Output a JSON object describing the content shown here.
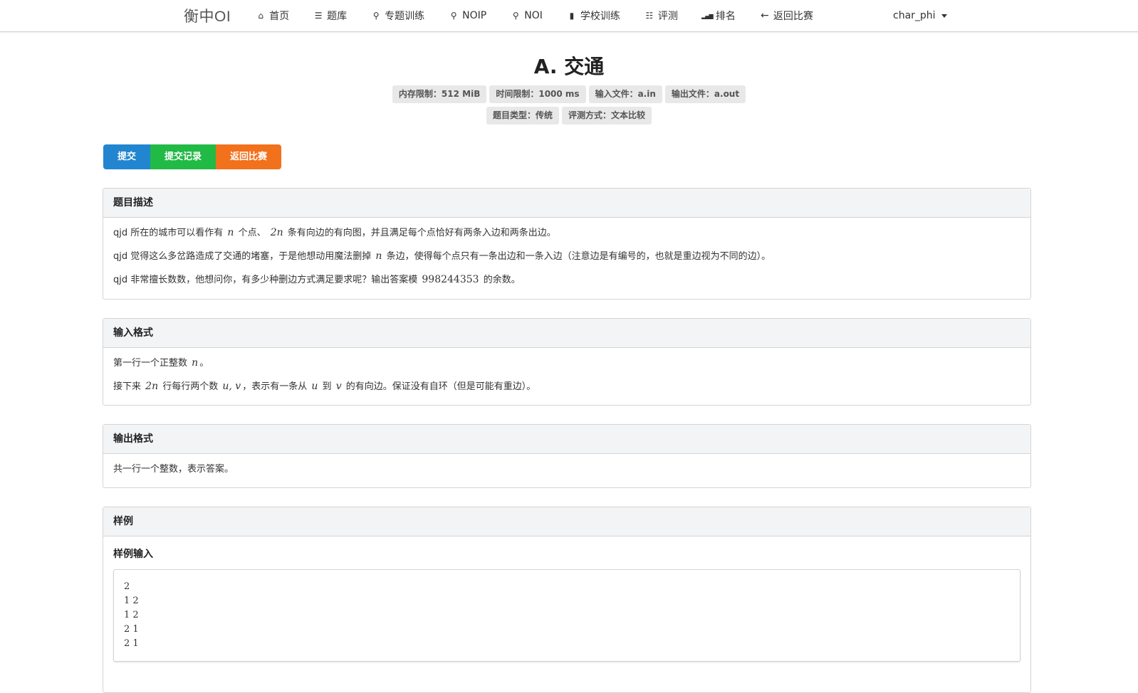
{
  "nav": {
    "brand": "衡中OI",
    "items": [
      {
        "icon": "home-icon",
        "glyph": "⌂",
        "label": "首页"
      },
      {
        "icon": "list-icon",
        "glyph": "☰",
        "label": "题库"
      },
      {
        "icon": "bicycle-icon",
        "glyph": "⚲",
        "label": "专题训练"
      },
      {
        "icon": "bicycle-icon",
        "glyph": "⚲",
        "label": "NOIP"
      },
      {
        "icon": "bicycle-icon",
        "glyph": "⚲",
        "label": "NOI"
      },
      {
        "icon": "building-icon",
        "glyph": "▮",
        "label": "学校训练"
      },
      {
        "icon": "tasks-icon",
        "glyph": "☷",
        "label": "评测"
      },
      {
        "icon": "signal-icon",
        "glyph": "▂▄▆",
        "label": "排名"
      },
      {
        "icon": "arrow-left-icon",
        "glyph": "←",
        "label": "返回比赛"
      }
    ],
    "user": "char_phi"
  },
  "problem": {
    "title": "A. 交通",
    "labels_row1": [
      "内存限制：512 MiB",
      "时间限制：1000 ms",
      "输入文件：a.in",
      "输出文件：a.out"
    ],
    "labels_row2": [
      "题目类型：传统",
      "评测方式：文本比较"
    ]
  },
  "buttons": {
    "submit": "提交",
    "records": "提交记录",
    "back": "返回比赛"
  },
  "description": {
    "header": "题目描述",
    "p1": {
      "a": "qjd 所在的城市可以看作有",
      "m1": "n",
      "b": "个点、",
      "m2": "2n",
      "c": "条有向边的有向图，并且满足每个点恰好有两条入边和两条出边。"
    },
    "p2": {
      "a": "qjd 觉得这么多岔路造成了交通的堵塞，于是他想动用魔法删掉",
      "m1": "n",
      "b": "条边，使得每个点只有一条出边和一条入边（注意边是有编号的，也就是重边视为不同的边）。"
    },
    "p3": {
      "a": "qjd 非常擅长数数，他想问你，有多少种删边方式满足要求呢？输出答案模",
      "m1": "998244353",
      "b": "的余数。"
    }
  },
  "input": {
    "header": "输入格式",
    "p1": {
      "a": "第一行一个正整数",
      "m1": "n",
      "b": "。"
    },
    "p2": {
      "a": "接下来",
      "m1": "2n",
      "b": "行每行两个数",
      "m2": "u, v",
      "c": "，表示有一条从",
      "m3": "u",
      "d": "到",
      "m4": "v",
      "e": "的有向边。保证没有自环（但是可能有重边）。"
    }
  },
  "output": {
    "header": "输出格式",
    "p1": "共一行一个整数，表示答案。"
  },
  "sample": {
    "header": "样例",
    "input_label": "样例输入",
    "input_text": "2\n1 2\n1 2\n2 1\n2 1"
  }
}
